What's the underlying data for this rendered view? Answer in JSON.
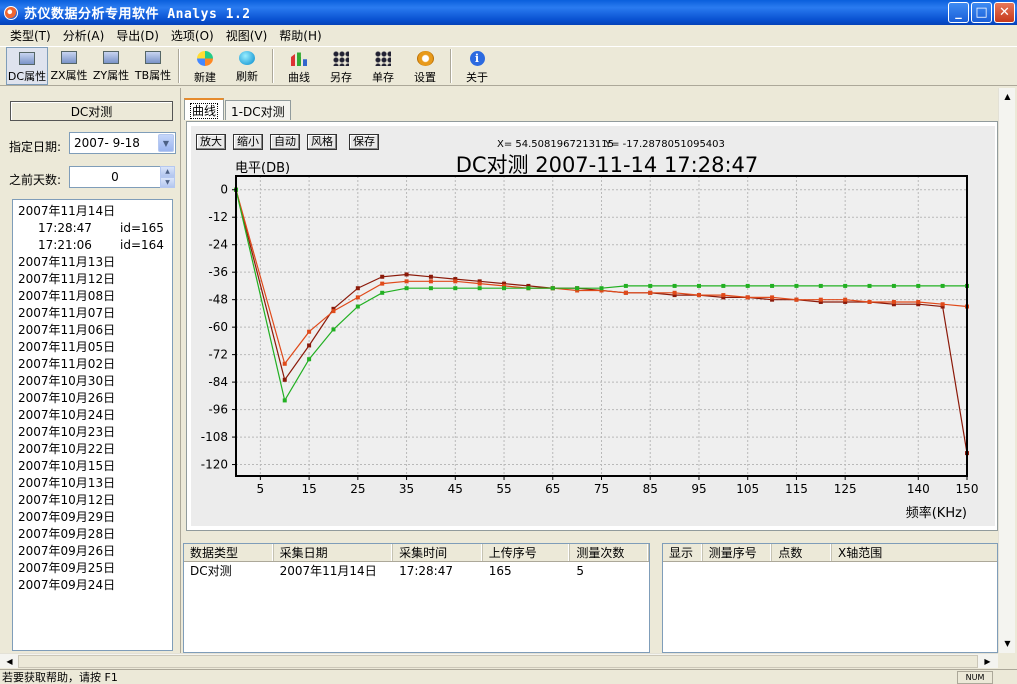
{
  "window": {
    "title": "苏仪数据分析专用软件 Analys 1.2",
    "buttons": {
      "minimize": "_",
      "maximize": "□",
      "close": "✕"
    }
  },
  "menu": [
    "类型(T)",
    "分析(A)",
    "导出(D)",
    "选项(O)",
    "视图(V)",
    "帮助(H)"
  ],
  "toolbar": {
    "dc": "DC属性",
    "zx": "ZX属性",
    "zy": "ZY属性",
    "tb": "TB属性",
    "new": "新建",
    "refresh": "刷新",
    "curve": "曲线",
    "save_as": "另存",
    "save_single": "单存",
    "settings": "设置",
    "about": "关于"
  },
  "left": {
    "panel_title": "DC对测",
    "date_label": "指定日期:",
    "date_value": "2007- 9-18",
    "days_label": "之前天数:",
    "days_value": "0",
    "tree": {
      "first_date": "2007年11月14日",
      "children": [
        {
          "time": "17:28:47",
          "id": "id=165"
        },
        {
          "time": "17:21:06",
          "id": "id=164"
        }
      ],
      "other_dates": [
        "2007年11月13日",
        "2007年11月12日",
        "2007年11月08日",
        "2007年11月07日",
        "2007年11月06日",
        "2007年11月05日",
        "2007年11月02日",
        "2007年10月30日",
        "2007年10月26日",
        "2007年10月24日",
        "2007年10月23日",
        "2007年10月22日",
        "2007年10月15日",
        "2007年10月13日",
        "2007年10月12日",
        "2007年09月29日",
        "2007年09月28日",
        "2007年09月26日",
        "2007年09月25日",
        "2007年09月24日"
      ]
    }
  },
  "tabs": [
    "曲线",
    "1-DC对测"
  ],
  "chart_buttons": {
    "zoom_in": "放大",
    "zoom_out": "缩小",
    "auto": "自动",
    "style": "风格",
    "save": "保存"
  },
  "coords": {
    "x": "X=  54.5081967213115",
    "y": "Y=  -17.2878051095403"
  },
  "chart_data": {
    "type": "line",
    "title": "DC对测 2007-11-14 17:28:47",
    "ylabel": "电平(DB)",
    "xlabel": "频率(KHz)",
    "xlim": [
      0,
      150
    ],
    "ylim": [
      -125,
      6
    ],
    "x_ticks": [
      5,
      15,
      25,
      35,
      45,
      55,
      65,
      75,
      85,
      95,
      105,
      115,
      125,
      140,
      150
    ],
    "y_ticks": [
      0,
      -12,
      -24,
      -36,
      -48,
      -60,
      -72,
      -84,
      -96,
      -108,
      -120
    ],
    "grid": true,
    "series": [
      {
        "color": "#8b1a0a",
        "x": [
          0,
          10,
          15,
          20,
          25,
          30,
          35,
          40,
          45,
          50,
          55,
          60,
          65,
          70,
          75,
          80,
          85,
          90,
          95,
          100,
          105,
          110,
          115,
          120,
          125,
          130,
          135,
          140,
          145,
          150
        ],
        "y": [
          0,
          -83,
          -68,
          -52,
          -43,
          -38,
          -37,
          -38,
          -39,
          -40,
          -41,
          -42,
          -43,
          -43,
          -44,
          -45,
          -45,
          -46,
          -46,
          -47,
          -47,
          -48,
          -48,
          -49,
          -49,
          -49,
          -50,
          -50,
          -51,
          -115
        ]
      },
      {
        "color": "#e04a1a",
        "x": [
          0,
          10,
          15,
          20,
          25,
          30,
          35,
          40,
          45,
          50,
          55,
          60,
          65,
          70,
          75,
          80,
          85,
          90,
          95,
          100,
          105,
          110,
          115,
          120,
          125,
          130,
          135,
          140,
          145,
          150
        ],
        "y": [
          0,
          -76,
          -62,
          -53,
          -47,
          -41,
          -40,
          -40,
          -40,
          -41,
          -42,
          -43,
          -43,
          -44,
          -44,
          -45,
          -45,
          -45,
          -46,
          -46,
          -47,
          -47,
          -48,
          -48,
          -48,
          -49,
          -49,
          -49,
          -50,
          -51
        ]
      },
      {
        "color": "#22b022",
        "x": [
          0,
          10,
          15,
          20,
          25,
          30,
          35,
          40,
          45,
          50,
          55,
          60,
          65,
          70,
          75,
          80,
          85,
          90,
          95,
          100,
          105,
          110,
          115,
          120,
          125,
          130,
          135,
          140,
          145,
          150
        ],
        "y": [
          0,
          -92,
          -74,
          -61,
          -51,
          -45,
          -43,
          -43,
          -43,
          -43,
          -43,
          -43,
          -43,
          -43,
          -43,
          -42,
          -42,
          -42,
          -42,
          -42,
          -42,
          -42,
          -42,
          -42,
          -42,
          -42,
          -42,
          -42,
          -42,
          -42
        ]
      }
    ]
  },
  "table_left": {
    "headers": [
      "数据类型",
      "采集日期",
      "采集时间",
      "上传序号",
      "测量次数"
    ],
    "rows": [
      [
        "DC对测",
        "2007年11月14日",
        "17:28:47",
        "165",
        "5"
      ]
    ]
  },
  "table_right": {
    "headers": [
      "显示",
      "测量序号",
      "点数",
      "X轴范围"
    ]
  },
  "status": {
    "text": "若要获取帮助，请按 F1",
    "pane": "NUM"
  }
}
